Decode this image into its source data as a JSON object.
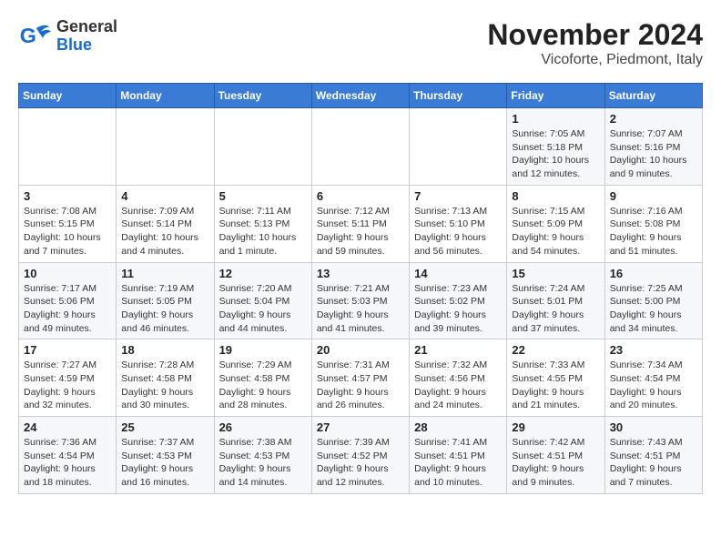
{
  "logo": {
    "text_general": "General",
    "text_blue": "Blue"
  },
  "title": "November 2024",
  "subtitle": "Vicoforte, Piedmont, Italy",
  "header_days": [
    "Sunday",
    "Monday",
    "Tuesday",
    "Wednesday",
    "Thursday",
    "Friday",
    "Saturday"
  ],
  "weeks": [
    [
      {
        "day": "",
        "info": ""
      },
      {
        "day": "",
        "info": ""
      },
      {
        "day": "",
        "info": ""
      },
      {
        "day": "",
        "info": ""
      },
      {
        "day": "",
        "info": ""
      },
      {
        "day": "1",
        "info": "Sunrise: 7:05 AM\nSunset: 5:18 PM\nDaylight: 10 hours and 12 minutes."
      },
      {
        "day": "2",
        "info": "Sunrise: 7:07 AM\nSunset: 5:16 PM\nDaylight: 10 hours and 9 minutes."
      }
    ],
    [
      {
        "day": "3",
        "info": "Sunrise: 7:08 AM\nSunset: 5:15 PM\nDaylight: 10 hours and 7 minutes."
      },
      {
        "day": "4",
        "info": "Sunrise: 7:09 AM\nSunset: 5:14 PM\nDaylight: 10 hours and 4 minutes."
      },
      {
        "day": "5",
        "info": "Sunrise: 7:11 AM\nSunset: 5:13 PM\nDaylight: 10 hours and 1 minute."
      },
      {
        "day": "6",
        "info": "Sunrise: 7:12 AM\nSunset: 5:11 PM\nDaylight: 9 hours and 59 minutes."
      },
      {
        "day": "7",
        "info": "Sunrise: 7:13 AM\nSunset: 5:10 PM\nDaylight: 9 hours and 56 minutes."
      },
      {
        "day": "8",
        "info": "Sunrise: 7:15 AM\nSunset: 5:09 PM\nDaylight: 9 hours and 54 minutes."
      },
      {
        "day": "9",
        "info": "Sunrise: 7:16 AM\nSunset: 5:08 PM\nDaylight: 9 hours and 51 minutes."
      }
    ],
    [
      {
        "day": "10",
        "info": "Sunrise: 7:17 AM\nSunset: 5:06 PM\nDaylight: 9 hours and 49 minutes."
      },
      {
        "day": "11",
        "info": "Sunrise: 7:19 AM\nSunset: 5:05 PM\nDaylight: 9 hours and 46 minutes."
      },
      {
        "day": "12",
        "info": "Sunrise: 7:20 AM\nSunset: 5:04 PM\nDaylight: 9 hours and 44 minutes."
      },
      {
        "day": "13",
        "info": "Sunrise: 7:21 AM\nSunset: 5:03 PM\nDaylight: 9 hours and 41 minutes."
      },
      {
        "day": "14",
        "info": "Sunrise: 7:23 AM\nSunset: 5:02 PM\nDaylight: 9 hours and 39 minutes."
      },
      {
        "day": "15",
        "info": "Sunrise: 7:24 AM\nSunset: 5:01 PM\nDaylight: 9 hours and 37 minutes."
      },
      {
        "day": "16",
        "info": "Sunrise: 7:25 AM\nSunset: 5:00 PM\nDaylight: 9 hours and 34 minutes."
      }
    ],
    [
      {
        "day": "17",
        "info": "Sunrise: 7:27 AM\nSunset: 4:59 PM\nDaylight: 9 hours and 32 minutes."
      },
      {
        "day": "18",
        "info": "Sunrise: 7:28 AM\nSunset: 4:58 PM\nDaylight: 9 hours and 30 minutes."
      },
      {
        "day": "19",
        "info": "Sunrise: 7:29 AM\nSunset: 4:58 PM\nDaylight: 9 hours and 28 minutes."
      },
      {
        "day": "20",
        "info": "Sunrise: 7:31 AM\nSunset: 4:57 PM\nDaylight: 9 hours and 26 minutes."
      },
      {
        "day": "21",
        "info": "Sunrise: 7:32 AM\nSunset: 4:56 PM\nDaylight: 9 hours and 24 minutes."
      },
      {
        "day": "22",
        "info": "Sunrise: 7:33 AM\nSunset: 4:55 PM\nDaylight: 9 hours and 21 minutes."
      },
      {
        "day": "23",
        "info": "Sunrise: 7:34 AM\nSunset: 4:54 PM\nDaylight: 9 hours and 20 minutes."
      }
    ],
    [
      {
        "day": "24",
        "info": "Sunrise: 7:36 AM\nSunset: 4:54 PM\nDaylight: 9 hours and 18 minutes."
      },
      {
        "day": "25",
        "info": "Sunrise: 7:37 AM\nSunset: 4:53 PM\nDaylight: 9 hours and 16 minutes."
      },
      {
        "day": "26",
        "info": "Sunrise: 7:38 AM\nSunset: 4:53 PM\nDaylight: 9 hours and 14 minutes."
      },
      {
        "day": "27",
        "info": "Sunrise: 7:39 AM\nSunset: 4:52 PM\nDaylight: 9 hours and 12 minutes."
      },
      {
        "day": "28",
        "info": "Sunrise: 7:41 AM\nSunset: 4:51 PM\nDaylight: 9 hours and 10 minutes."
      },
      {
        "day": "29",
        "info": "Sunrise: 7:42 AM\nSunset: 4:51 PM\nDaylight: 9 hours and 9 minutes."
      },
      {
        "day": "30",
        "info": "Sunrise: 7:43 AM\nSunset: 4:51 PM\nDaylight: 9 hours and 7 minutes."
      }
    ]
  ]
}
